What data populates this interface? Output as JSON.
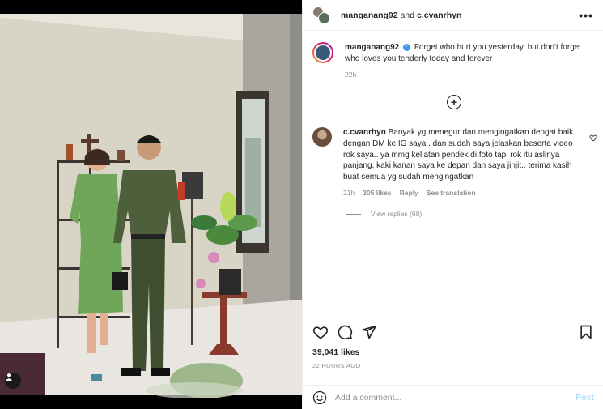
{
  "header": {
    "user1": "manganang92",
    "joiner": "and",
    "user2": "c.cvanrhyn",
    "more_icon": "more-horizontal-icon"
  },
  "caption": {
    "username": "manganang92",
    "verified_icon": "verified-badge-icon",
    "text": "Forget who hurt you yesterday, but don't forget who loves you tenderly today and forever",
    "time": "22h"
  },
  "load_more_icon": "plus-circle-icon",
  "comment": {
    "username": "c.cvanrhyn",
    "text": "Banyak yg menegur dan mengingatkan dengat baik dengan DM ke IG saya.. dan sudah saya jelaskan beserta video rok saya.. ya mmg keliatan pendek di foto tapi rok itu aslinya panjang, kaki kanan saya ke depan dan saya jinjit.. terima kasih buat semua yg sudah mengingatkan",
    "time": "21h",
    "likes": "305 likes",
    "reply": "Reply",
    "translate": "See translation",
    "view_replies": "View replies (68)"
  },
  "actions": {
    "like_icon": "heart-icon",
    "comment_icon": "comment-icon",
    "share_icon": "send-icon",
    "save_icon": "bookmark-icon"
  },
  "likes": "39,041 likes",
  "posted": "22 HOURS AGO",
  "add_comment": {
    "placeholder": "Add a comment...",
    "post_label": "Post",
    "emoji_icon": "emoji-icon"
  },
  "media": {
    "tag_icon": "user-tag-icon"
  },
  "colors": {
    "accent": "#3897f0",
    "post_disabled": "#b2dffc",
    "muted": "#8e8e8e"
  }
}
